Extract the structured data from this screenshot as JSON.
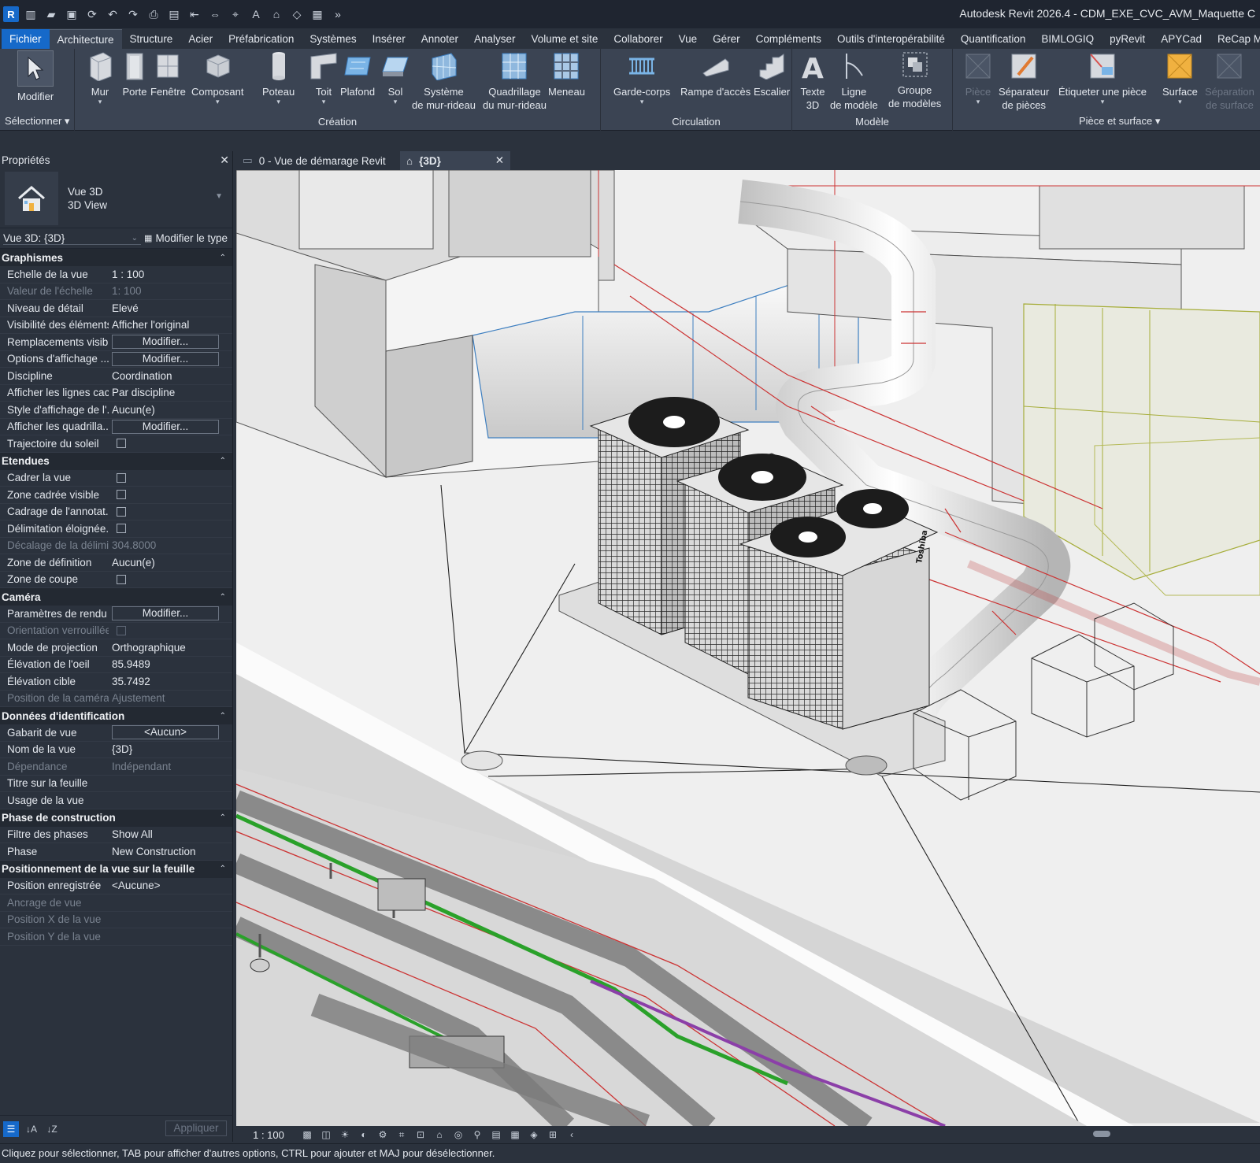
{
  "app": {
    "title": "Autodesk Revit 2026.4 - CDM_EXE_CVC_AVM_Maquette C"
  },
  "menu": [
    "Fichier",
    "Architecture",
    "Structure",
    "Acier",
    "Préfabrication",
    "Systèmes",
    "Insérer",
    "Annoter",
    "Analyser",
    "Volume et site",
    "Collaborer",
    "Vue",
    "Gérer",
    "Compléments",
    "Outils d'interopérabilité",
    "Quantification",
    "BIMLOGIQ",
    "pyRevit",
    "APYCad",
    "ReCap Mesh"
  ],
  "ribbon": {
    "select": {
      "modify": "Modifier",
      "group": "Sélectionner"
    },
    "creation": {
      "group": "Création",
      "wall": "Mur",
      "door": "Porte",
      "window": "Fenêtre",
      "component": "Composant",
      "column": "Poteau",
      "roof": "Toit",
      "ceiling": "Plafond",
      "floor": "Sol",
      "curtain_system_1": "Système",
      "curtain_system_2": "de mur-rideau",
      "curtain_grid_1": "Quadrillage",
      "curtain_grid_2": "du mur-rideau",
      "mullion": "Meneau"
    },
    "circulation": {
      "group": "Circulation",
      "railing": "Garde-corps",
      "ramp": "Rampe d'accès",
      "stair": "Escalier"
    },
    "model": {
      "group": "Modèle",
      "text_1": "Texte",
      "text_2": "3D",
      "line_1": "Ligne",
      "line_2": "de modèle",
      "mgroup_1": "Groupe",
      "mgroup_2": "de modèles"
    },
    "room": {
      "group": "Pièce et surface",
      "room": "Pièce",
      "sep_1": "Séparateur",
      "sep_2": "de pièces",
      "tag_room": "Étiqueter une pièce",
      "area": "Surface",
      "area_sep_1": "Séparation",
      "area_sep_2": "de surface"
    }
  },
  "properties": {
    "title": "Propriétés",
    "type_line1": "Vue 3D",
    "type_line2": "3D View",
    "filter": "Vue 3D: {3D}",
    "edit_type": "Modifier le type",
    "apply": "Appliquer",
    "sections": [
      {
        "title": "Graphismes",
        "rows": [
          {
            "k": "Echelle de la vue",
            "v": "1 : 100"
          },
          {
            "k": "Valeur de l'échelle",
            "v": "1:   100",
            "dim": true
          },
          {
            "k": "Niveau de détail",
            "v": "Elevé"
          },
          {
            "k": "Visibilité des éléments",
            "v": "Afficher l'original"
          },
          {
            "k": "Remplacements visib...",
            "btn": "Modifier..."
          },
          {
            "k": "Options d'affichage ...",
            "btn": "Modifier..."
          },
          {
            "k": "Discipline",
            "v": "Coordination"
          },
          {
            "k": "Afficher les lignes cac...",
            "v": "Par discipline"
          },
          {
            "k": "Style d'affichage de l'...",
            "v": "Aucun(e)"
          },
          {
            "k": "Afficher les quadrilla...",
            "btn": "Modifier..."
          },
          {
            "k": "Trajectoire du soleil",
            "chk": true
          }
        ]
      },
      {
        "title": "Etendues",
        "rows": [
          {
            "k": "Cadrer la vue",
            "chk": true
          },
          {
            "k": "Zone cadrée visible",
            "chk": true
          },
          {
            "k": "Cadrage de l'annotat...",
            "chk": true
          },
          {
            "k": "Délimitation éloignée...",
            "chk": true
          },
          {
            "k": "Décalage de la délimi...",
            "v": "304.8000",
            "dim": true
          },
          {
            "k": "Zone de définition",
            "v": "Aucun(e)"
          },
          {
            "k": "Zone de coupe",
            "chk": true
          }
        ]
      },
      {
        "title": "Caméra",
        "rows": [
          {
            "k": "Paramètres de rendu",
            "btn": "Modifier..."
          },
          {
            "k": "Orientation verrouillée",
            "chk": true,
            "dim": true
          },
          {
            "k": "Mode de projection",
            "v": "Orthographique"
          },
          {
            "k": "Élévation de l'oeil",
            "v": "85.9489"
          },
          {
            "k": "Élévation cible",
            "v": "35.7492"
          },
          {
            "k": "Position de la caméra",
            "v": "Ajustement",
            "dim": true
          }
        ]
      },
      {
        "title": "Données d'identification",
        "rows": [
          {
            "k": "Gabarit de vue",
            "btn": "<Aucun>"
          },
          {
            "k": "Nom de la vue",
            "v": "{3D}"
          },
          {
            "k": "Dépendance",
            "v": "Indépendant",
            "dim": true
          },
          {
            "k": "Titre sur la feuille",
            "v": ""
          },
          {
            "k": "Usage de la vue",
            "v": ""
          }
        ]
      },
      {
        "title": "Phase de construction",
        "rows": [
          {
            "k": "Filtre des phases",
            "v": "Show All"
          },
          {
            "k": "Phase",
            "v": "New Construction"
          }
        ]
      },
      {
        "title": "Positionnement de la vue sur la feuille",
        "rows": [
          {
            "k": "Position enregistrée",
            "v": "<Aucune>"
          },
          {
            "k": "Ancrage de vue",
            "v": "",
            "dim": true
          },
          {
            "k": "Position X de la vue",
            "v": "",
            "dim": true
          },
          {
            "k": "Position Y de la vue",
            "v": "",
            "dim": true
          }
        ]
      }
    ]
  },
  "tabs": {
    "start": "0 - Vue de démarage Revit",
    "view3d": "{3D}"
  },
  "viewport": {
    "brand_label": "Toshiba"
  },
  "viewbar": {
    "scale": "1 : 100"
  },
  "status": "Cliquez pour sélectionner, TAB pour afficher d'autres options,  CTRL pour ajouter et MAJ pour désélectionner."
}
